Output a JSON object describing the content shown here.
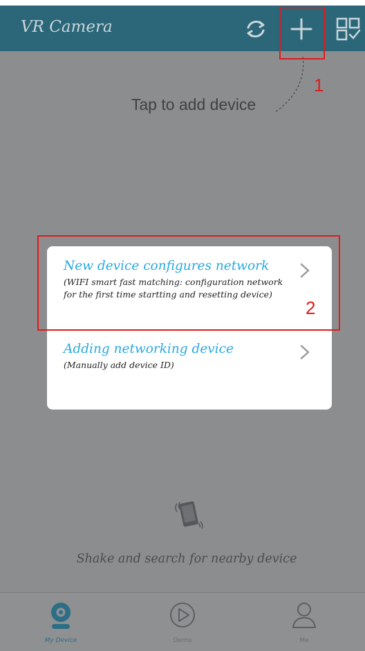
{
  "app": {
    "title": "VR Camera"
  },
  "toolbar": {
    "refresh_icon": "refresh-icon",
    "add_icon": "plus-icon",
    "scan_icon": "grid-check-icon"
  },
  "annotations": {
    "step1": "1",
    "step2": "2",
    "color": "#e01b1b"
  },
  "hint_text": "Tap to add device",
  "dialog": {
    "options": [
      {
        "title": "New device configures network",
        "subtitle": "(WIFI smart fast matching: configuration network for the first time startting and resetting device)"
      },
      {
        "title": "Adding networking device",
        "subtitle": "(Manually add device ID)"
      }
    ]
  },
  "shake": {
    "icon": "shake-phone-icon",
    "text": "Shake and search for nearby device"
  },
  "tabs": [
    {
      "label": "My Device",
      "icon": "camera-icon",
      "active": true
    },
    {
      "label": "Demo",
      "icon": "play-icon",
      "active": false
    },
    {
      "label": "Me",
      "icon": "person-icon",
      "active": false
    }
  ],
  "colors": {
    "appbar": "#2b6779",
    "accent": "#28a8e0",
    "overlay": "#8c8d8f"
  }
}
